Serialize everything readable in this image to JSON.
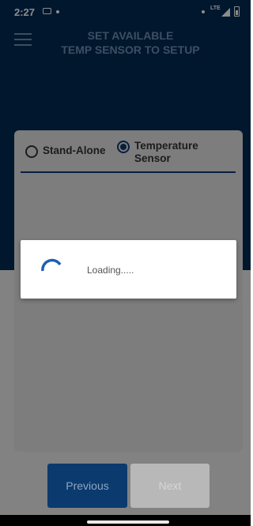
{
  "status_bar": {
    "time": "2:27",
    "network": "LTE"
  },
  "header": {
    "title_line1": "SET AVAILABLE",
    "title_line2": "TEMP SENSOR TO SETUP"
  },
  "mode_selector": {
    "options": [
      {
        "label": "Stand-Alone",
        "selected": false
      },
      {
        "label": "Temperature Sensor",
        "selected": true
      }
    ]
  },
  "loading_dialog": {
    "message": "Loading....."
  },
  "footer": {
    "previous_label": "Previous",
    "next_label": "Next"
  },
  "icons": [
    "menu-icon",
    "signal-icon",
    "battery-icon",
    "spinner-icon"
  ],
  "colors": {
    "primary": "#022a55",
    "accent": "#0d3a73",
    "disabled": "#b8b8b8",
    "spinner": "#1a5fb4"
  }
}
